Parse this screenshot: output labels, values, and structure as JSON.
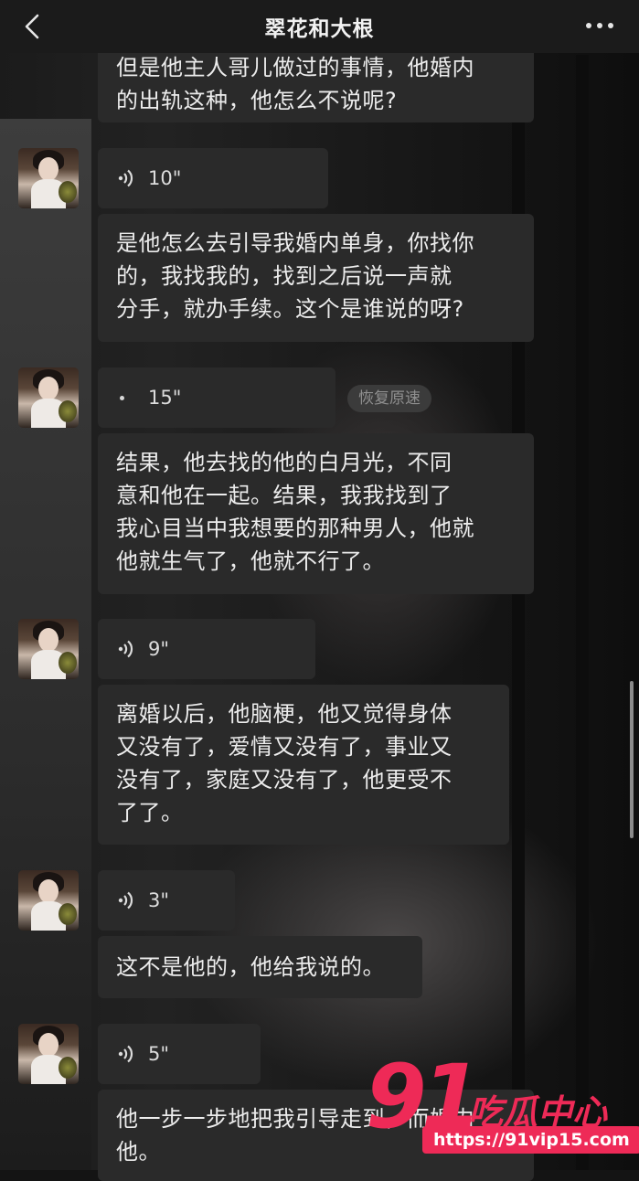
{
  "header": {
    "title": "翠花和大根"
  },
  "messages": {
    "m0_line1": "但是他主人哥儿做过的事情，他婚内",
    "m0_line2": "的出轨这种，他怎么不说呢?",
    "v1": "10\"",
    "m1_line1": "是他怎么去引导我婚内单身，你找你",
    "m1_line2": "的，我找我的，找到之后说一声就",
    "m1_line3": "分手，就办手续。这个是谁说的呀?",
    "v2": "15\"",
    "speed_restore": "恢复原速",
    "m2_line1": "结果，他去找的他的白月光，不同",
    "m2_line2": "意和他在一起。结果，我我找到了",
    "m2_line3": "我心目当中我想要的那种男人，他就",
    "m2_line4": "他就生气了，他就不行了。",
    "v3": "9\"",
    "m3_line1": "离婚以后，他脑梗，他又觉得身体",
    "m3_line2": "又没有了，爱情又没有了，事业又",
    "m3_line3": "没有了，家庭又没有了，他更受不",
    "m3_line4": "了了。",
    "v4": "3\"",
    "m4_line1": "这不是他的，他给我说的。",
    "v5": "5\"",
    "m5_line1": "他一步一步地把我引导走到，而婚内",
    "m5_line2": "他。"
  },
  "watermark": {
    "number": "91",
    "brand": "吃瓜中心",
    "url": "https://91vip15.com"
  },
  "colors": {
    "bubble": "#2a2a2a",
    "header": "#1b1b1b",
    "watermark": "#ee2a57"
  },
  "icons": [
    "back-icon",
    "more-icon",
    "voice-wave-icon",
    "avatar"
  ]
}
